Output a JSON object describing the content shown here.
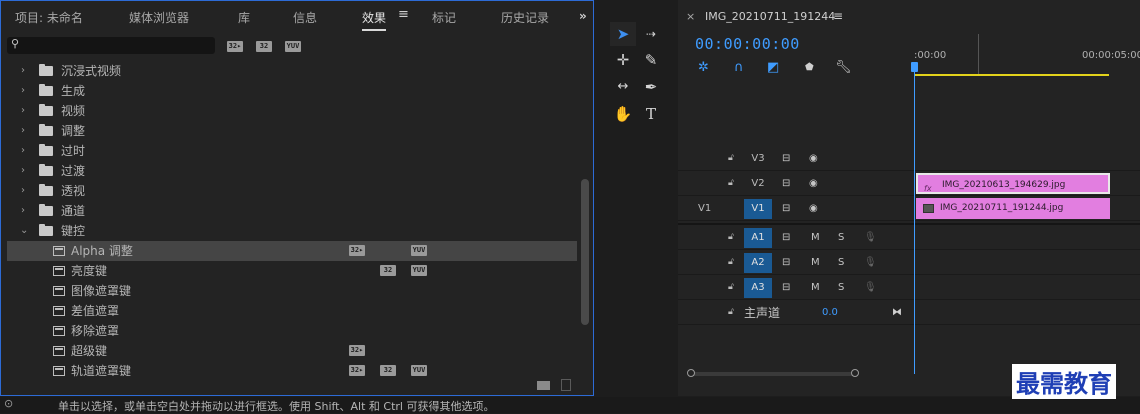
{
  "project_panel": {
    "tabs": [
      {
        "label": "项目: 未命名"
      },
      {
        "label": "媒体浏览器"
      },
      {
        "label": "库"
      },
      {
        "label": "信息"
      },
      {
        "label": "效果"
      },
      {
        "label": "标记"
      },
      {
        "label": "历史记录"
      }
    ],
    "active_tab": "效果",
    "search": {
      "value": "",
      "placeholder": ""
    },
    "badges": {
      "accel": "32▸",
      "bit32": "32",
      "yuv": "YUV"
    },
    "categories": [
      {
        "label": "沉浸式视频"
      },
      {
        "label": "生成"
      },
      {
        "label": "视频"
      },
      {
        "label": "调整"
      },
      {
        "label": "过时"
      },
      {
        "label": "过渡"
      },
      {
        "label": "透视"
      },
      {
        "label": "通道"
      },
      {
        "label": "键控"
      }
    ],
    "keying_effects": [
      {
        "label": "Alpha 调整"
      },
      {
        "label": "亮度键"
      },
      {
        "label": "图像遮罩键"
      },
      {
        "label": "差值遮罩"
      },
      {
        "label": "移除遮罩"
      },
      {
        "label": "超级键"
      },
      {
        "label": "轨道遮罩键"
      }
    ]
  },
  "timeline": {
    "sequence_name": "IMG_20210711_191244",
    "timecode": "00:00:00:00",
    "ruler": {
      "start": ":00:00",
      "end": "00:00:05:00"
    },
    "tracks": {
      "v3": "V3",
      "v2": "V2",
      "v1": "V1",
      "v1_source": "V1",
      "a1": "A1",
      "a2": "A2",
      "a3": "A3",
      "mute": "M",
      "solo": "S",
      "master_label": "主声道",
      "master_value": "0.0"
    },
    "clips": {
      "v2": "IMG_20210613_194629.jpg",
      "v1": "IMG_20210711_191244.jpg",
      "fx_badge": "fx"
    }
  },
  "status_bar": {
    "text": "单击以选择，或单击空白处并拖动以进行框选。使用 Shift、Alt 和 Ctrl 可获得其他选项。"
  },
  "watermark": {
    "text": "最需教育"
  }
}
